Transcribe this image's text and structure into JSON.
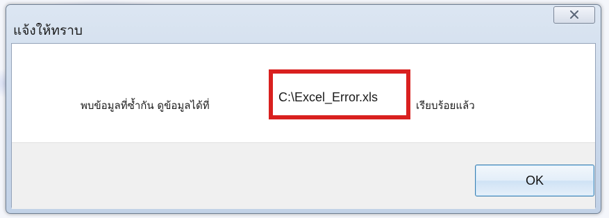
{
  "dialog": {
    "title": "แจ้งให้ทราบ",
    "close_icon": "close-x-icon",
    "message": {
      "before": "พบข้อมูลที่ซ้ำกัน ดูข้อมูลได้ที่",
      "path": "C:\\Excel_Error.xls",
      "after": "เรียบร้อยแล้ว"
    },
    "ok_label": "OK",
    "highlight_color": "#d9201f"
  }
}
